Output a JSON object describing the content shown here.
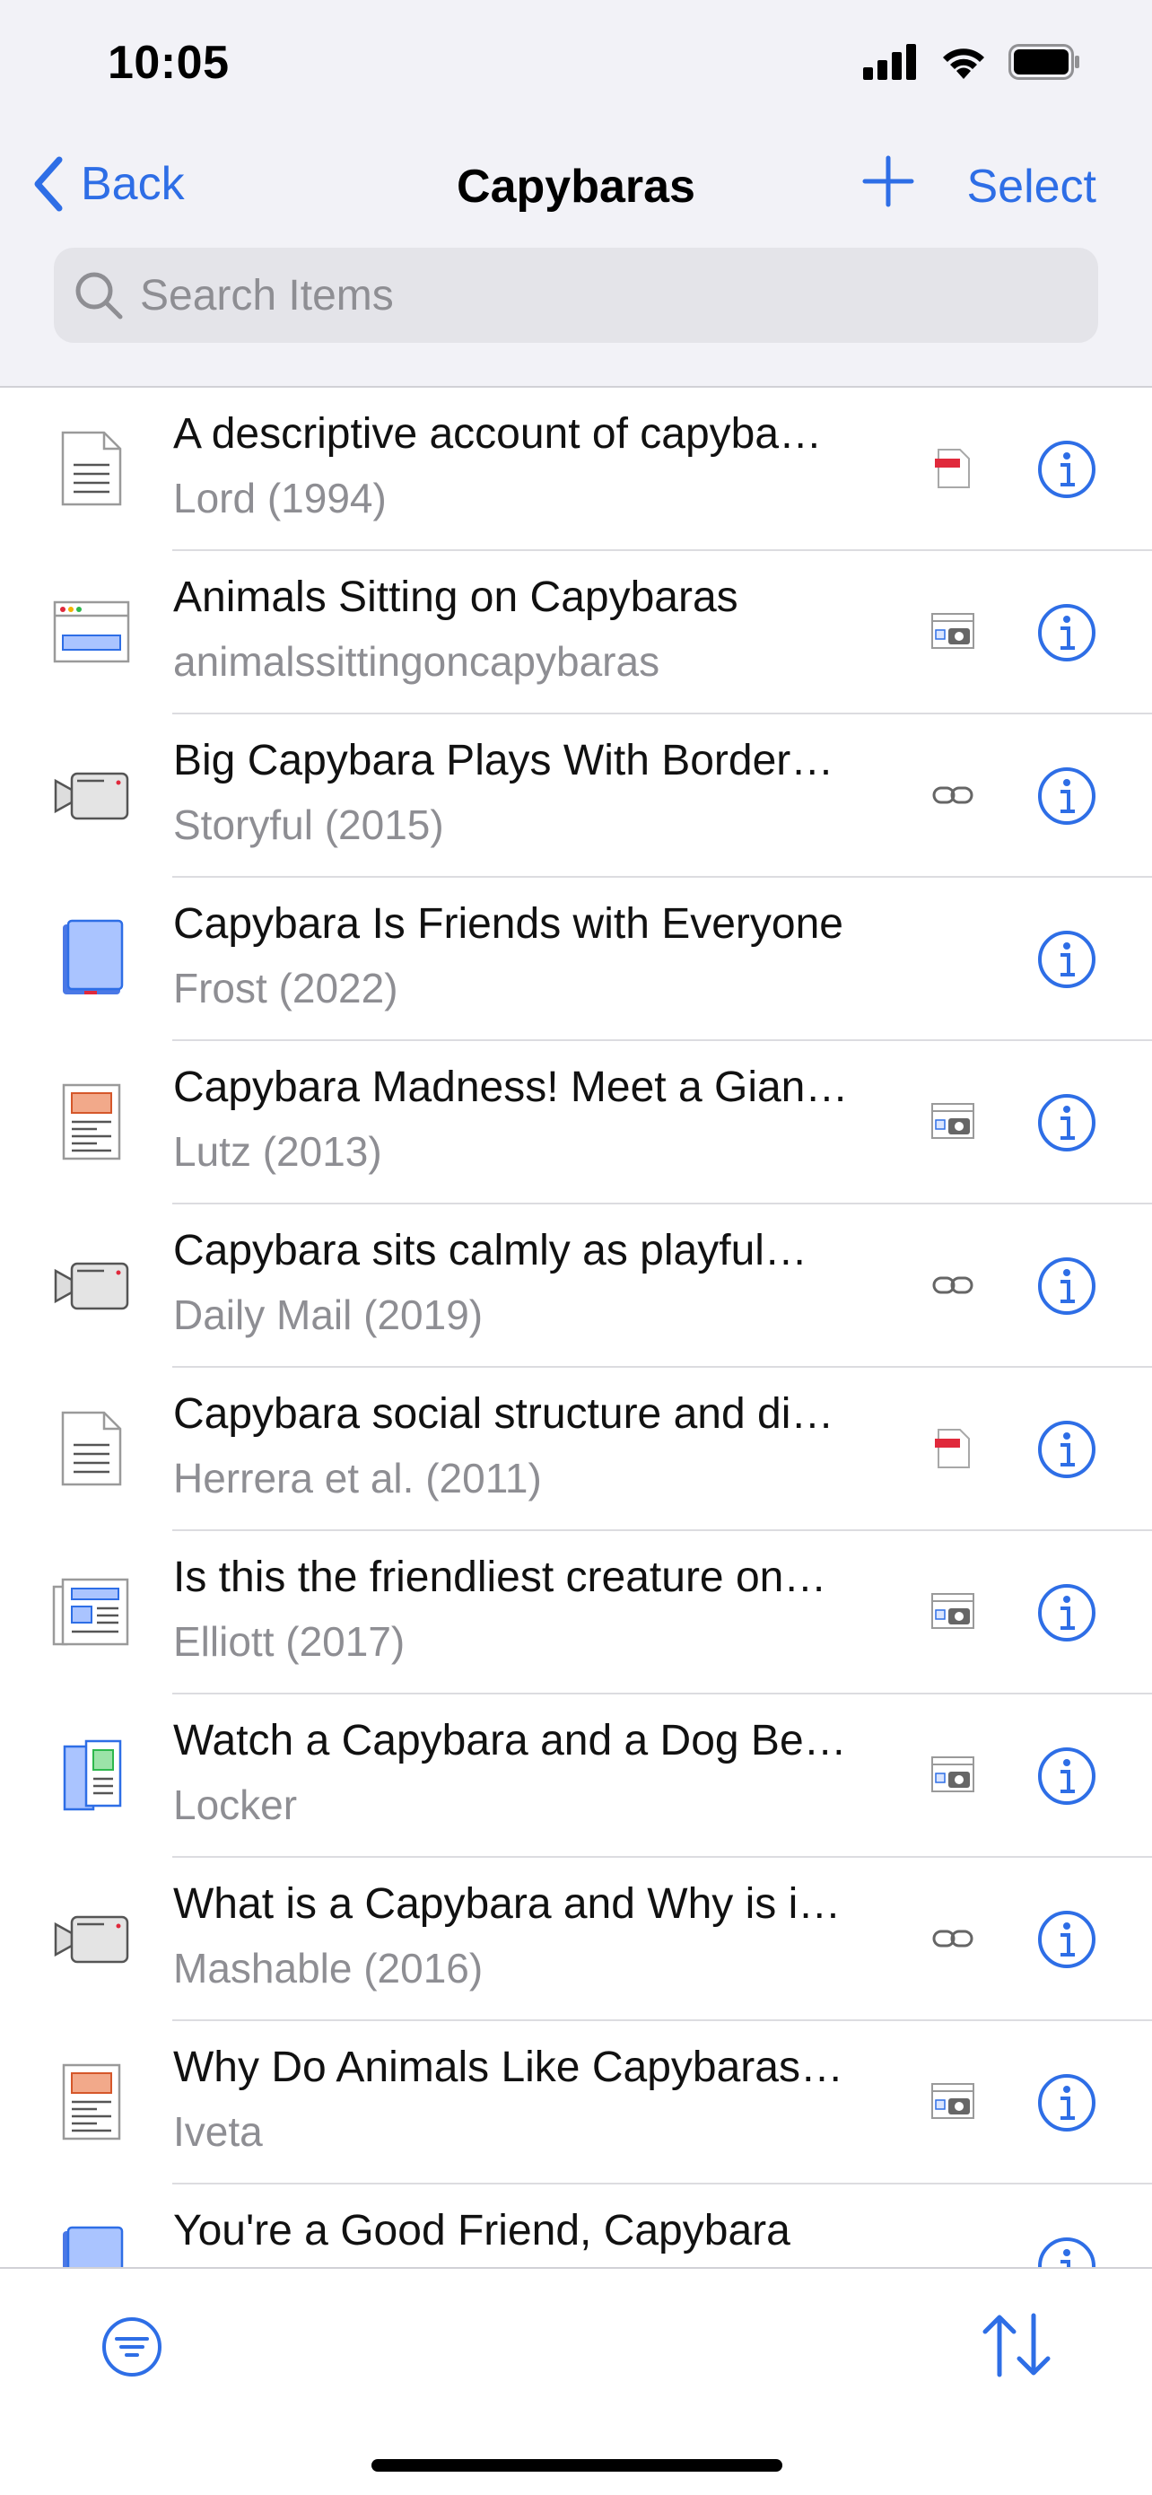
{
  "status": {
    "time": "10:05"
  },
  "nav": {
    "back_label": "Back",
    "title": "Capybaras",
    "select_label": "Select"
  },
  "search": {
    "placeholder": "Search Items"
  },
  "colors": {
    "accent": "#2e6ee6",
    "secondary_text": "#8e8e93"
  },
  "items": [
    {
      "title": "A descriptive account of capyba…",
      "subtitle": "Lord (1994)",
      "type_icon": "document-icon",
      "attachment_icon": "pdf-attachment-icon"
    },
    {
      "title": "Animals Sitting on Capybaras",
      "subtitle": "animalssittingoncapybaras",
      "type_icon": "webpage-icon",
      "attachment_icon": "snapshot-attachment-icon"
    },
    {
      "title": "Big Capybara Plays With Border…",
      "subtitle": "Storyful (2015)",
      "type_icon": "video-icon",
      "attachment_icon": "link-attachment-icon"
    },
    {
      "title": "Capybara Is Friends with Everyone",
      "subtitle": "Frost (2022)",
      "type_icon": "book-icon",
      "attachment_icon": ""
    },
    {
      "title": "Capybara Madness! Meet a Gian…",
      "subtitle": "Lutz (2013)",
      "type_icon": "magazine-article-icon",
      "attachment_icon": "snapshot-attachment-icon"
    },
    {
      "title": "Capybara sits calmly as playful…",
      "subtitle": "Daily Mail (2019)",
      "type_icon": "video-icon",
      "attachment_icon": "link-attachment-icon"
    },
    {
      "title": "Capybara social structure and di…",
      "subtitle": "Herrera et al. (2011)",
      "type_icon": "document-icon",
      "attachment_icon": "pdf-attachment-icon"
    },
    {
      "title": "Is this the friendliest creature on…",
      "subtitle": "Elliott (2017)",
      "type_icon": "newspaper-article-icon",
      "attachment_icon": "snapshot-attachment-icon"
    },
    {
      "title": "Watch a Capybara and a Dog Be…",
      "subtitle": "Locker",
      "type_icon": "blog-post-icon",
      "attachment_icon": "snapshot-attachment-icon"
    },
    {
      "title": "What is a Capybara and Why is i…",
      "subtitle": "Mashable (2016)",
      "type_icon": "video-icon",
      "attachment_icon": "link-attachment-icon"
    },
    {
      "title": "Why Do Animals Like Capybaras…",
      "subtitle": "Iveta",
      "type_icon": "magazine-article-icon",
      "attachment_icon": "snapshot-attachment-icon"
    },
    {
      "title": "You're a Good Friend, Capybara",
      "subtitle": "",
      "type_icon": "book-icon",
      "attachment_icon": ""
    }
  ],
  "toolbar": {
    "filter_icon": "filter-icon",
    "sort_icon": "sort-icon"
  }
}
